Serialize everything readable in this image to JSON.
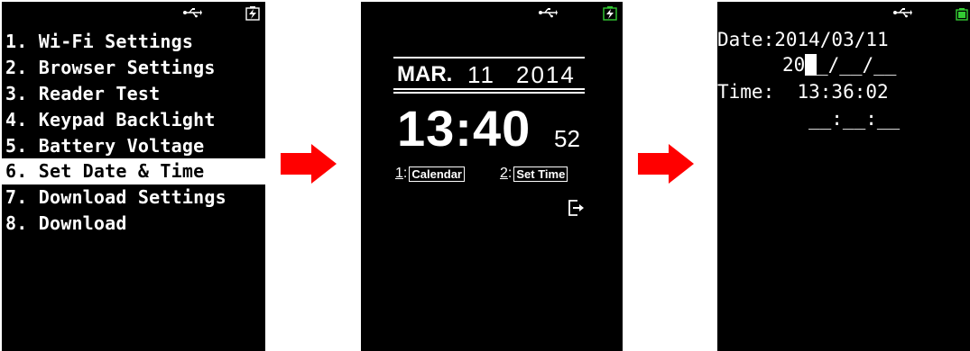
{
  "screen1": {
    "menu": [
      {
        "label": "1. Wi-Fi Settings"
      },
      {
        "label": "2. Browser Settings"
      },
      {
        "label": "3. Reader Test"
      },
      {
        "label": "4. Keypad Backlight"
      },
      {
        "label": "5. Battery Voltage"
      },
      {
        "label": "6. Set Date & Time",
        "selected": true
      },
      {
        "label": "7. Download Settings"
      },
      {
        "label": "8. Download"
      }
    ]
  },
  "screen2": {
    "month": "MAR.",
    "day": "11",
    "year": "2014",
    "time": "13:40",
    "seconds": "52",
    "option1_num": "1",
    "option1_label": "Calendar",
    "option2_num": "2",
    "option2_label": "Set Time"
  },
  "screen3": {
    "date_line": "Date:2014/03/11",
    "date_input_prefix": "20",
    "date_input_rest": "_/__/__",
    "time_line": "Time:  13:36:02",
    "time_input": "__:__:__"
  },
  "icons": {
    "usb": "usb-icon",
    "charging": "charging-battery-icon",
    "battery": "battery-full-icon",
    "arrow": "right-arrow-icon",
    "exit": "exit-icon"
  },
  "colors": {
    "arrow": "#ff0000",
    "battery": "#33cc33",
    "screen_bg": "#000000",
    "text": "#ffffff"
  }
}
